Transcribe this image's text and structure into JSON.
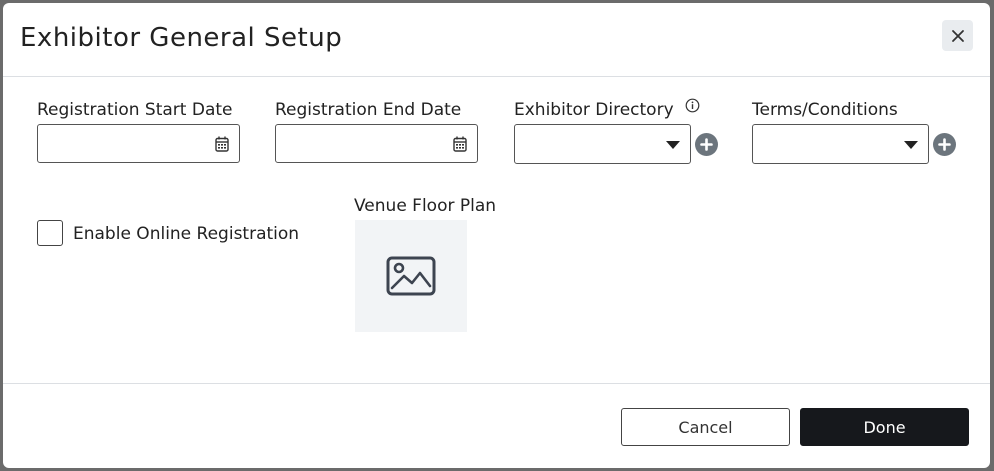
{
  "dialog": {
    "title": "Exhibitor General Setup",
    "close_icon": "close-icon"
  },
  "fields": {
    "registration_start": {
      "label": "Registration Start Date",
      "value": "",
      "icon": "calendar-icon"
    },
    "registration_end": {
      "label": "Registration End Date",
      "value": "",
      "icon": "calendar-icon"
    },
    "exhibitor_directory": {
      "label": "Exhibitor Directory",
      "value": "",
      "info_icon": "info-icon",
      "add_icon": "plus-circle-icon"
    },
    "terms_conditions": {
      "label": "Terms/Conditions",
      "value": "",
      "add_icon": "plus-circle-icon"
    }
  },
  "online_registration": {
    "label": "Enable Online Registration",
    "checked": false
  },
  "floor_plan": {
    "label": "Venue Floor Plan",
    "icon": "image-placeholder-icon"
  },
  "footer": {
    "cancel_label": "Cancel",
    "done_label": "Done"
  },
  "colors": {
    "done_bg": "#16181c",
    "add_icon_bg": "#6c757d",
    "close_bg": "#e9ecef",
    "placeholder_bg": "#f2f4f6"
  }
}
